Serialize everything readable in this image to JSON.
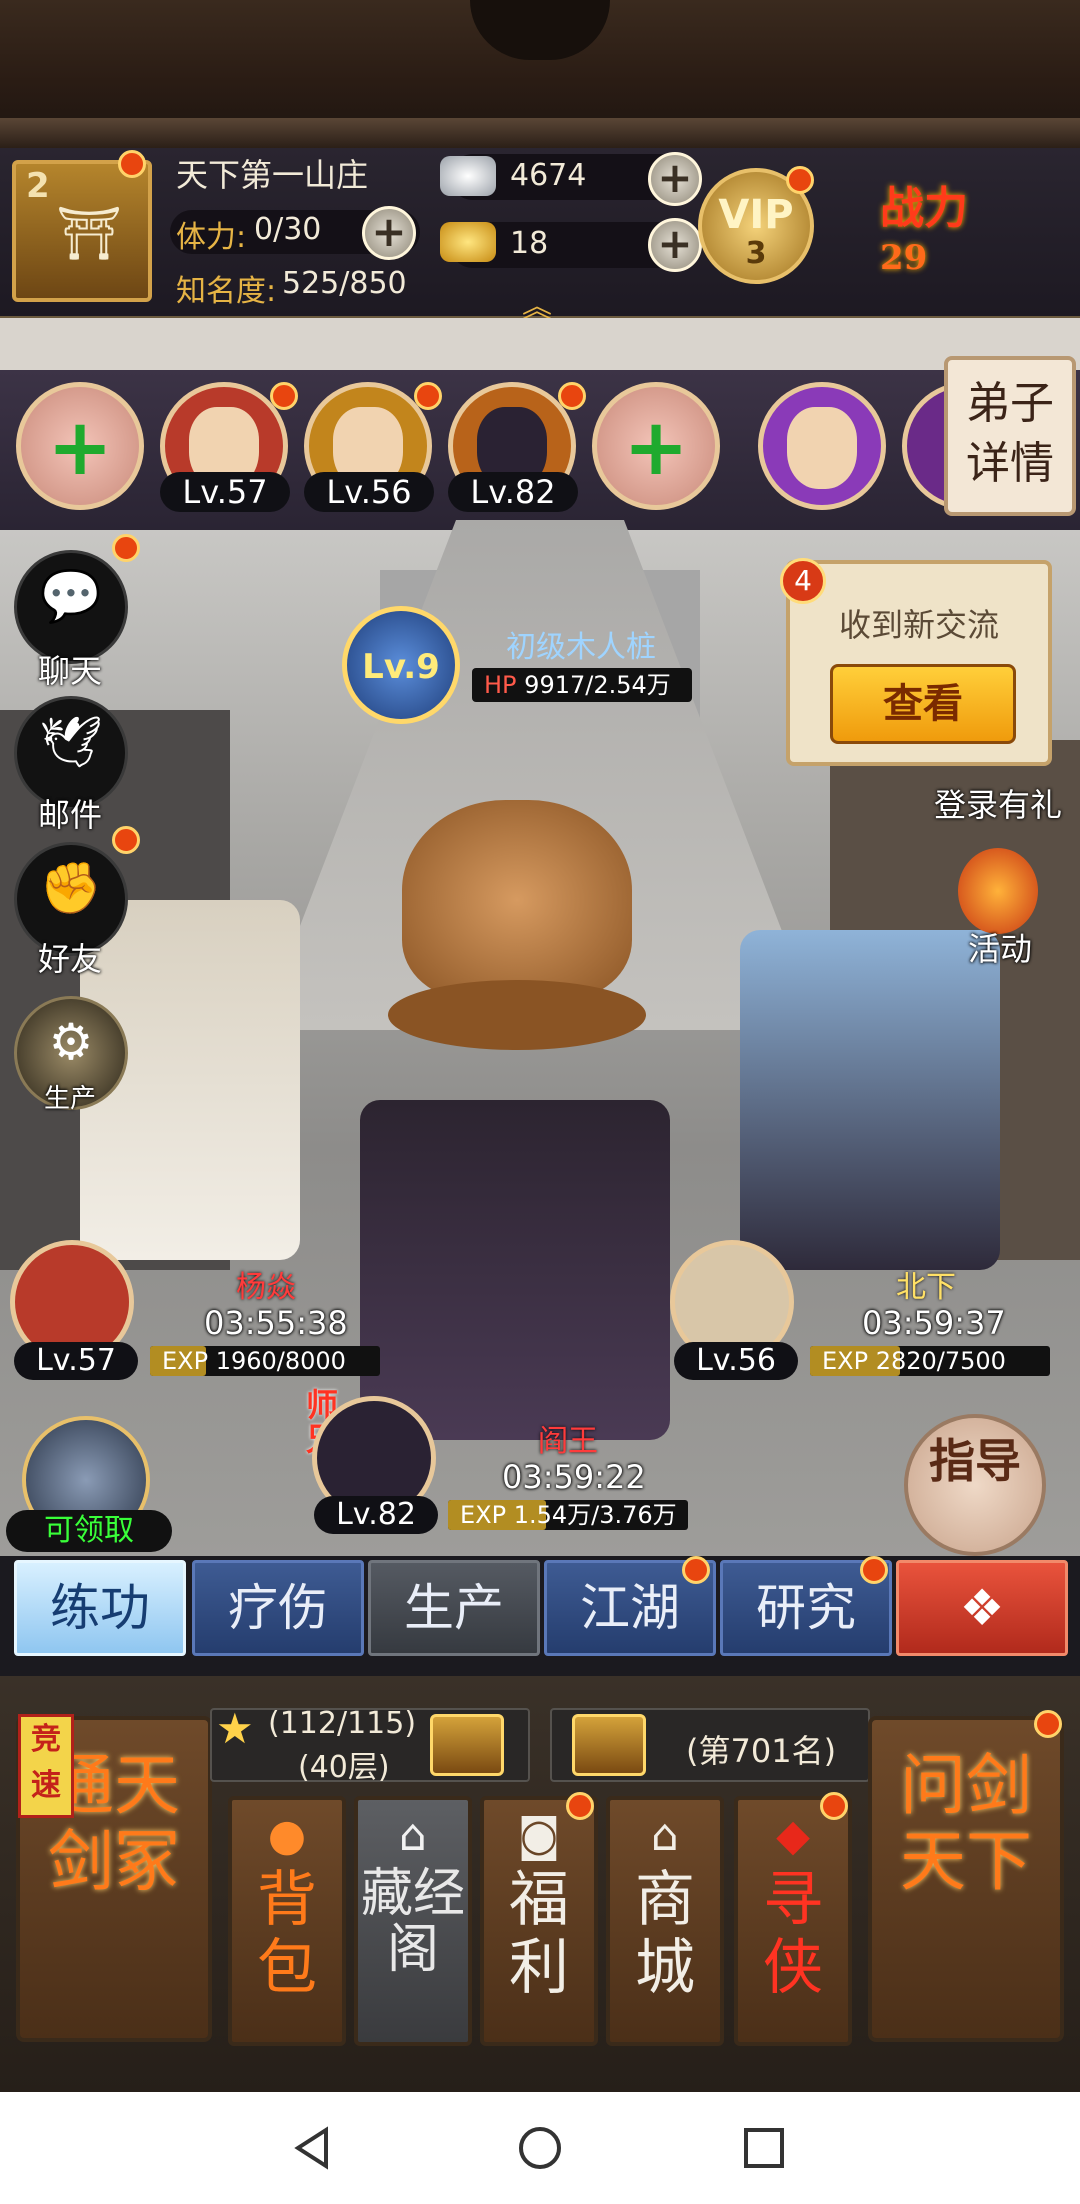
{
  "player": {
    "rank": "2",
    "name": "天下第一山庄",
    "stamina_label": "体力:",
    "stamina_value": "0/30",
    "fame_label": "知名度:",
    "fame_value": "525/850",
    "silver": "4674",
    "gold": "18",
    "vip_label": "VIP",
    "vip_level": "3",
    "power_label": "战力",
    "power_value": "29"
  },
  "disciples_strip": {
    "detail_button": "弟子详情",
    "levels": [
      "Lv.57",
      "Lv.56",
      "Lv.82"
    ]
  },
  "side_menu": [
    {
      "label": "聊天",
      "icon": "chat-icon"
    },
    {
      "label": "邮件",
      "icon": "mail-dove-icon"
    },
    {
      "label": "好友",
      "icon": "friends-icon"
    },
    {
      "label": "生产",
      "icon": "production-icon"
    }
  ],
  "target": {
    "level": "Lv.9",
    "name": "初级木人桩",
    "hp_label": "HP",
    "hp_value": "9917/2.54万"
  },
  "notification": {
    "count": "4",
    "text": "收到新交流",
    "button": "查看"
  },
  "right_menu": {
    "login_gift": "登录有礼",
    "activity": "活动"
  },
  "training": [
    {
      "name": "杨焱",
      "time": "03:55:38",
      "level": "Lv.57",
      "exp": "EXP 1960/8000",
      "exp_fraction": 0.245
    },
    {
      "name": "北下",
      "time": "03:59:37",
      "level": "Lv.56",
      "exp": "EXP 2820/7500",
      "exp_fraction": 0.376
    },
    {
      "name": "阎王",
      "time": "03:59:22",
      "level": "Lv.82",
      "exp": "EXP 1.54万/3.76万",
      "exp_fraction": 0.41,
      "badge": "师兄"
    }
  ],
  "claim_label": "可领取",
  "guide_label": "指导",
  "tabs": [
    "练功",
    "疗伤",
    "生产",
    "江湖",
    "研究"
  ],
  "bottom": {
    "race_tag": "竞速",
    "left_card": "通天剑冢",
    "floor_progress": "(112/115)",
    "floor_level": "(40层)",
    "rank_text": "(第701名)",
    "right_card": "问剑天下",
    "cards": [
      {
        "label": "背包",
        "icon": "bag-icon"
      },
      {
        "label": "藏经阁",
        "icon": "pavilion-icon"
      },
      {
        "label": "福利",
        "icon": "coin-icon"
      },
      {
        "label": "商城",
        "icon": "shop-icon"
      },
      {
        "label": "寻侠",
        "icon": "search-hero-icon"
      }
    ]
  },
  "colors": {
    "accent_gold": "#e6b445",
    "notification_red": "#e8450f",
    "tab_active": "#8fc6f0",
    "claim_green": "#39ff39"
  }
}
